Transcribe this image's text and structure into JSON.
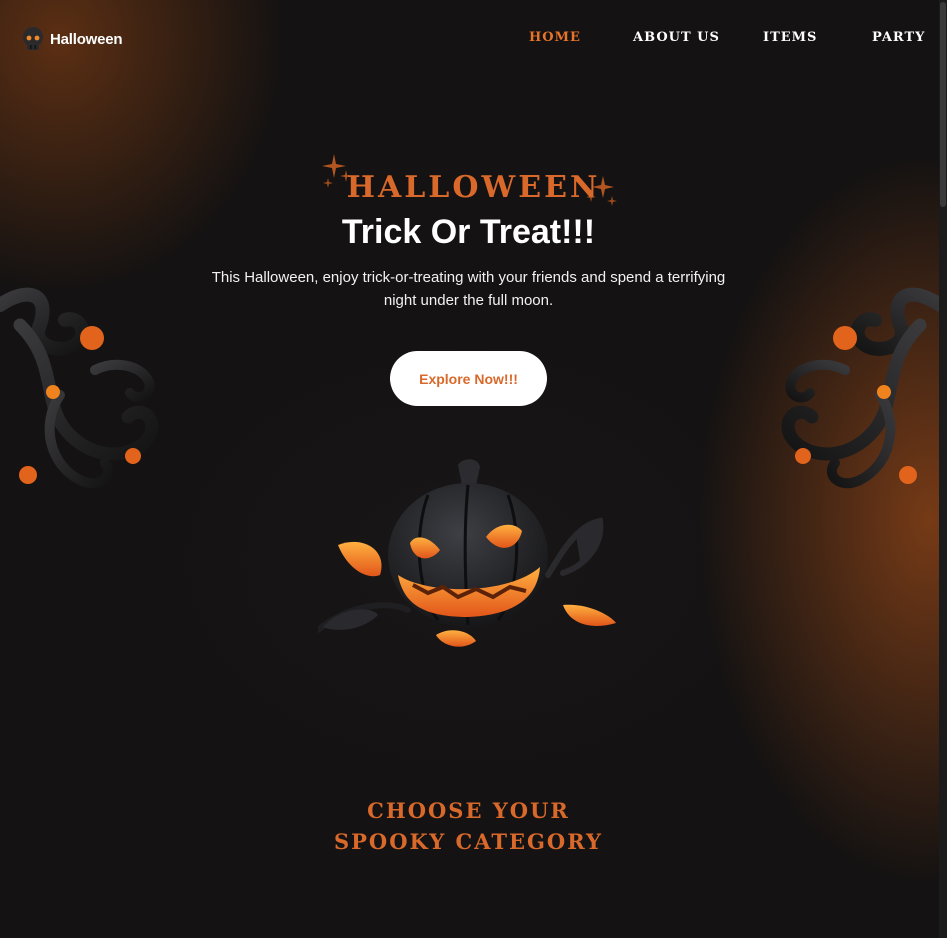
{
  "header": {
    "logo_text": "Halloween",
    "nav": [
      {
        "label": "Home",
        "active": true
      },
      {
        "label": "About Us",
        "active": false
      },
      {
        "label": "Items",
        "active": false
      },
      {
        "label": "Party",
        "active": false
      }
    ]
  },
  "hero": {
    "kicker": "Halloween",
    "title": "Trick Or Treat!!!",
    "description": "This Halloween, enjoy trick-or-treating with your friends and spend a terrifying night under the full moon.",
    "cta_label": "Explore Now!!!"
  },
  "category_section": {
    "title_line1": "Choose your",
    "title_line2": "spooky category"
  },
  "colors": {
    "accent": "#d8692a",
    "background": "#141212",
    "button_bg": "#ffffff"
  },
  "icons": {
    "logo": "skull-icon",
    "decor": [
      "sparkle-stars-icon",
      "twisted-vine-icon",
      "jack-o-lantern-icon"
    ]
  }
}
